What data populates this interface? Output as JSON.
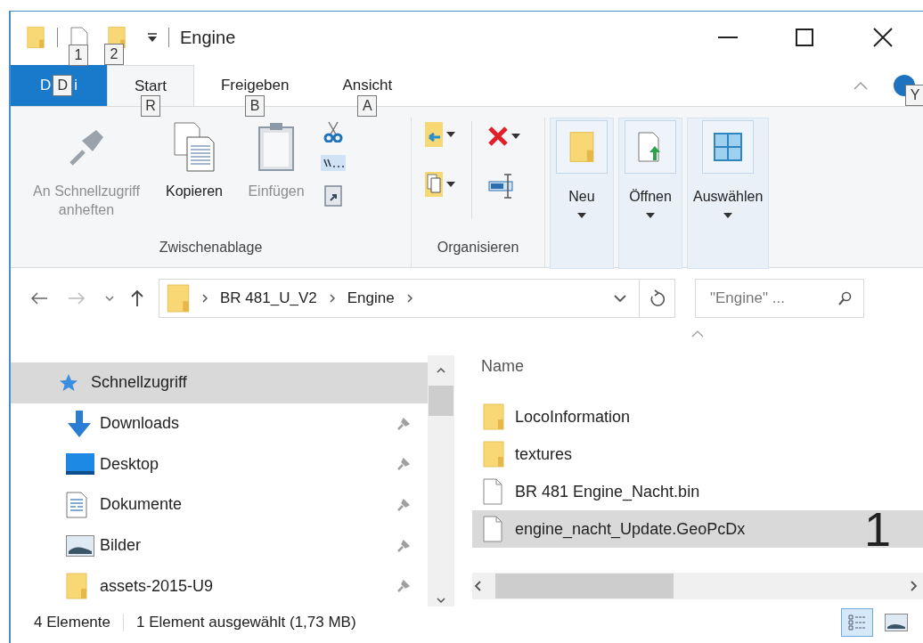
{
  "window": {
    "title": "Engine",
    "qat_keytips": [
      "1",
      "2"
    ]
  },
  "tabs": [
    {
      "kind": "file",
      "label_before": "D",
      "keytip": "D",
      "label_after": "i",
      "selected": false
    },
    {
      "kind": "tab",
      "label": "Start",
      "keytip": "R",
      "selected": true
    },
    {
      "kind": "tab",
      "label": "Freigeben",
      "keytip": "B",
      "selected": false
    },
    {
      "kind": "tab",
      "label": "Ansicht",
      "keytip": "A",
      "selected": false
    }
  ],
  "help_keytip": "Y",
  "ribbon": {
    "clipboard": {
      "label": "Zwischenablage",
      "buttons": [
        {
          "kind": "pin",
          "label": "An Schnellzugriff anheften",
          "disabled": true
        },
        {
          "kind": "copy",
          "label": "Kopieren",
          "disabled": false
        },
        {
          "kind": "paste",
          "label": "Einfügen",
          "disabled": true
        }
      ]
    },
    "organize": {
      "label": "Organisieren"
    },
    "collapsed_groups": [
      {
        "kind": "new",
        "label": "Neu"
      },
      {
        "kind": "open",
        "label": "Öffnen"
      },
      {
        "kind": "select",
        "label": "Auswählen"
      }
    ]
  },
  "address": {
    "crumbs": [
      "BR 481_U_V2",
      "Engine"
    ]
  },
  "search": {
    "placeholder": "\"Engine\" ..."
  },
  "sidebar": {
    "items": [
      {
        "kind": "quick",
        "label": "Schnellzugriff",
        "selected": true,
        "pinned": false
      },
      {
        "kind": "downloads",
        "label": "Downloads",
        "selected": false,
        "pinned": true
      },
      {
        "kind": "desktop",
        "label": "Desktop",
        "selected": false,
        "pinned": true
      },
      {
        "kind": "documents",
        "label": "Dokumente",
        "selected": false,
        "pinned": true
      },
      {
        "kind": "pictures",
        "label": "Bilder",
        "selected": false,
        "pinned": true
      },
      {
        "kind": "folder",
        "label": "assets-2015-U9",
        "selected": false,
        "pinned": true
      }
    ]
  },
  "files": {
    "column": "Name",
    "rows": [
      {
        "kind": "folder",
        "name": "LocoInformation",
        "selected": false
      },
      {
        "kind": "folder",
        "name": "textures",
        "selected": false
      },
      {
        "kind": "file",
        "name": "BR 481 Engine_Nacht.bin",
        "selected": false
      },
      {
        "kind": "file",
        "name": "engine_nacht_Update.GeoPcDx",
        "selected": true,
        "annotation": "1"
      }
    ]
  },
  "status_bar": {
    "count": "4 Elemente",
    "selection": "1 Element ausgewählt (1,73 MB)",
    "views": [
      {
        "kind": "details",
        "selected": true
      },
      {
        "kind": "tiles",
        "selected": false
      }
    ]
  }
}
